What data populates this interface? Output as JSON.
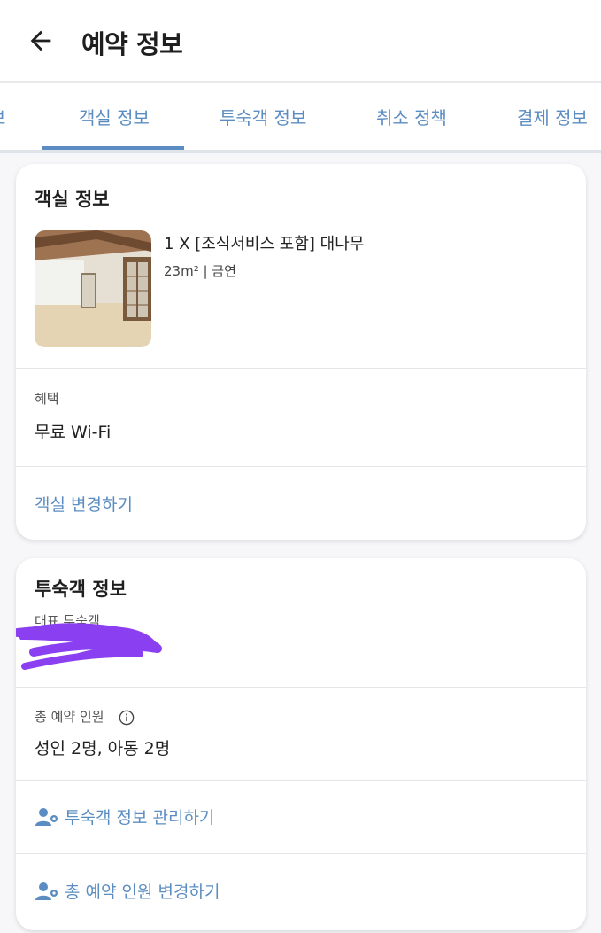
{
  "appbar": {
    "title": "예약 정보",
    "back_icon": "arrow-left-icon"
  },
  "tabs": {
    "items": [
      {
        "label": "보"
      },
      {
        "label": "객실 정보"
      },
      {
        "label": "투숙객 정보"
      },
      {
        "label": "취소 정책"
      },
      {
        "label": "결제 정보"
      }
    ],
    "active_index": 1
  },
  "room_card": {
    "title": "객실 정보",
    "room_name": "1 X [조식서비스 포함] 대나무",
    "room_meta": "23m² | 금연",
    "benefit_label": "혜택",
    "benefit_value": "무료 Wi-Fi",
    "change_room_link": "객실 변경하기"
  },
  "guest_card": {
    "title": "투숙객 정보",
    "lead_guest_label": "대표 투숙객",
    "total_guests_label": "총 예약 인원",
    "total_guests_value": "성인 2명, 아동 2명",
    "manage_guests_link": "투숙객 정보 관리하기",
    "change_guests_link": "총 예약 인원 변경하기"
  },
  "colors": {
    "accent": "#5b8dc2",
    "redaction": "#8a3ff0",
    "background": "#f7f7f9"
  }
}
